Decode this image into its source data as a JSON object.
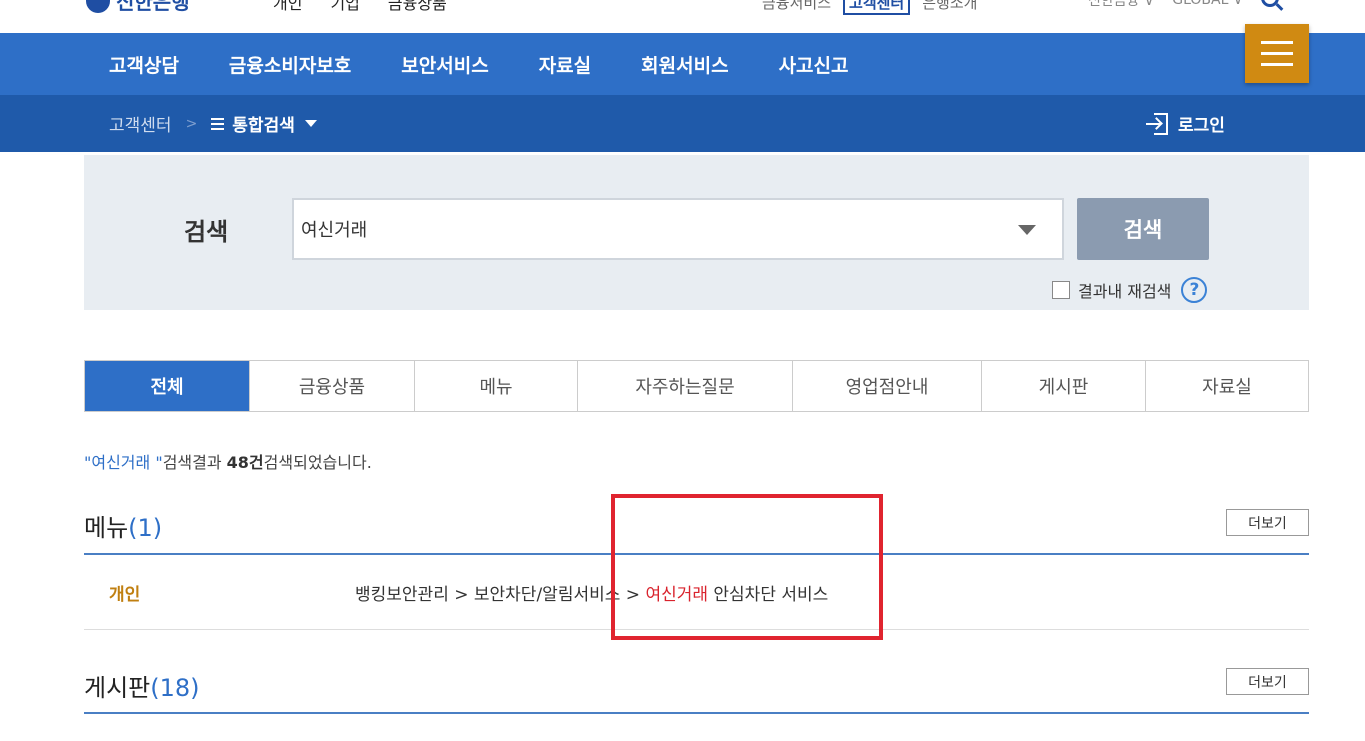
{
  "brand": {
    "logo_text": "신한은행"
  },
  "top_nav": [
    "개인",
    "기업",
    "금융상품"
  ],
  "top_util": {
    "left": "금융서비스",
    "boxed": "고객센터",
    "right": "은행소개"
  },
  "top_right": {
    "site": "신한금융 ∨",
    "global": "GLOBAL ∨"
  },
  "main_nav": [
    "고객상담",
    "금융소비자보호",
    "보안서비스",
    "자료실",
    "회원서비스",
    "사고신고"
  ],
  "breadcrumb": {
    "root": "고객센터",
    "current": "통합검색"
  },
  "login_label": "로그인",
  "search": {
    "label": "검색",
    "value": "여신거래",
    "button": "검색",
    "research_label": "결과내 재검색",
    "help": "?"
  },
  "tabs": [
    "전체",
    "금융상품",
    "메뉴",
    "자주하는질문",
    "영업점안내",
    "게시판",
    "자료실"
  ],
  "result_summary": {
    "keyword": "\"여신거래 \"",
    "mid": "검색결과 ",
    "count": "48건",
    "tail": "검색되었습니다."
  },
  "sections": {
    "menu": {
      "title": "메뉴",
      "count": "(1)",
      "more": "더보기"
    },
    "board": {
      "title": "게시판",
      "count": "(18)",
      "more": "더보기"
    }
  },
  "menu_result": {
    "category": "개인",
    "path_prefix": "뱅킹보안관리 > 보안차단/알림서비스 > ",
    "highlight": "여신거래",
    "path_suffix": " 안심차단 서비스"
  },
  "colors": {
    "main_nav_bg": "#2e6fc7",
    "sub_nav_bg": "#1f5aaa",
    "hamburger_bg": "#d08a12",
    "highlight_red": "#d9232d",
    "annotation_red": "#e0242f",
    "category_gold": "#c07f10"
  }
}
